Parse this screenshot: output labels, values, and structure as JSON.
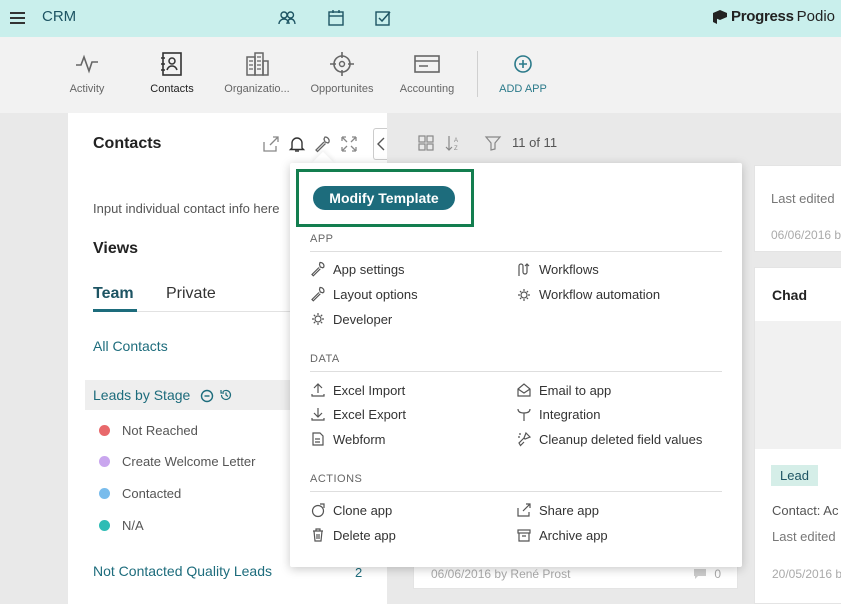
{
  "topbar": {
    "title": "CRM",
    "brand_bold": "Progress",
    "brand_light": "Podio"
  },
  "apps": [
    {
      "label": "Activity",
      "icon": "activity-icon"
    },
    {
      "label": "Contacts",
      "icon": "contacts-icon"
    },
    {
      "label": "Organizatio...",
      "icon": "organization-icon"
    },
    {
      "label": "Opportunites",
      "icon": "opportunities-icon"
    },
    {
      "label": "Accounting",
      "icon": "accounting-icon"
    },
    {
      "label": "ADD APP",
      "icon": "add-icon"
    }
  ],
  "left_panel": {
    "title": "Contacts",
    "description": "Input individual contact info here",
    "views_heading": "Views",
    "tabs": [
      "Team",
      "Private"
    ],
    "all_contacts": "All Contacts",
    "selected_view": "Leads by Stage",
    "stages": [
      {
        "label": "Not Reached",
        "color": "#e8686b"
      },
      {
        "label": "Create Welcome Letter",
        "color": "#c9a6ee"
      },
      {
        "label": "Contacted",
        "color": "#79bcec"
      },
      {
        "label": "N/A",
        "color": "#2fbcb5"
      }
    ],
    "not_contacted": "Not Contacted Quality Leads",
    "not_contacted_count": "2"
  },
  "toolbar": {
    "filter_count": "11 of 11"
  },
  "mid_card": {
    "meta": "06/06/2016 by René Prost",
    "comments": "0"
  },
  "right_cards": {
    "card1_edited": "Last edited",
    "card1_date": "06/06/2016 b",
    "card2_name": "Chad",
    "card2_badge": "Lead",
    "card2_contact": "Contact: Ac",
    "card2_edited": "Last edited",
    "card2_date": "20/05/2016 b"
  },
  "dropdown": {
    "modify_button": "Modify Template",
    "sections": {
      "app": "APP",
      "data": "DATA",
      "actions": "ACTIONS"
    },
    "app_items": {
      "app_settings": "App settings",
      "layout_options": "Layout options",
      "developer": "Developer",
      "workflows": "Workflows",
      "workflow_automation": "Workflow automation"
    },
    "data_items": {
      "excel_import": "Excel Import",
      "excel_export": "Excel Export",
      "webform": "Webform",
      "email_to_app": "Email to app",
      "integration": "Integration",
      "cleanup": "Cleanup deleted field values"
    },
    "action_items": {
      "clone_app": "Clone app",
      "delete_app": "Delete app",
      "share_app": "Share app",
      "archive_app": "Archive app"
    }
  },
  "colors": {
    "topbar": "#c9efec",
    "accent": "#1d6c7c",
    "highlight": "#137e4f"
  }
}
